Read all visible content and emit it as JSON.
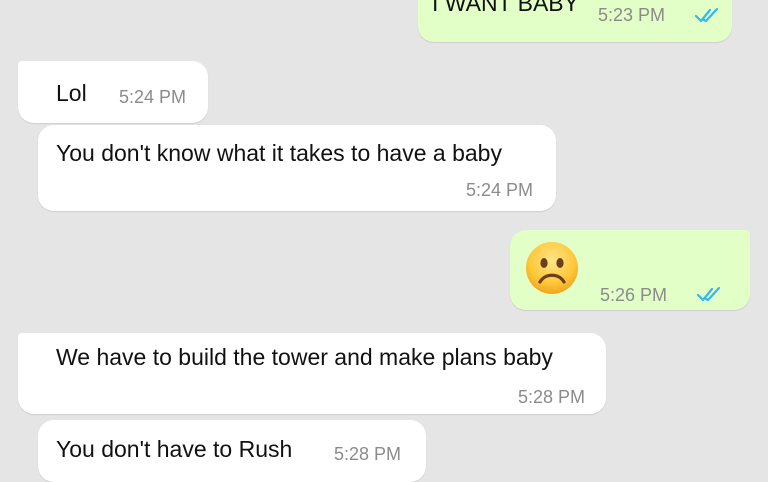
{
  "messages": [
    {
      "direction": "outgoing",
      "text": "I WANT BABY",
      "time": "5:23 PM",
      "status_icon": "double-check-read-icon"
    },
    {
      "direction": "incoming",
      "text": "Lol",
      "time": "5:24 PM"
    },
    {
      "direction": "incoming",
      "text": "You don't know what it takes to have a baby",
      "time": "5:24 PM"
    },
    {
      "direction": "outgoing",
      "emoji": "frowning-face-emoji",
      "text": "☹",
      "time": "5:26 PM",
      "status_icon": "double-check-read-icon"
    },
    {
      "direction": "incoming",
      "text": "We have to build the tower and make plans baby",
      "time": "5:28 PM"
    },
    {
      "direction": "incoming",
      "text": "You don't have to Rush",
      "time": "5:28 PM"
    }
  ],
  "colors": {
    "background": "#e5e5e5",
    "incoming_bubble": "#ffffff",
    "outgoing_bubble": "#e2ffc7",
    "read_ticks": "#34b7f1",
    "timestamp": "#8b8b8b"
  }
}
